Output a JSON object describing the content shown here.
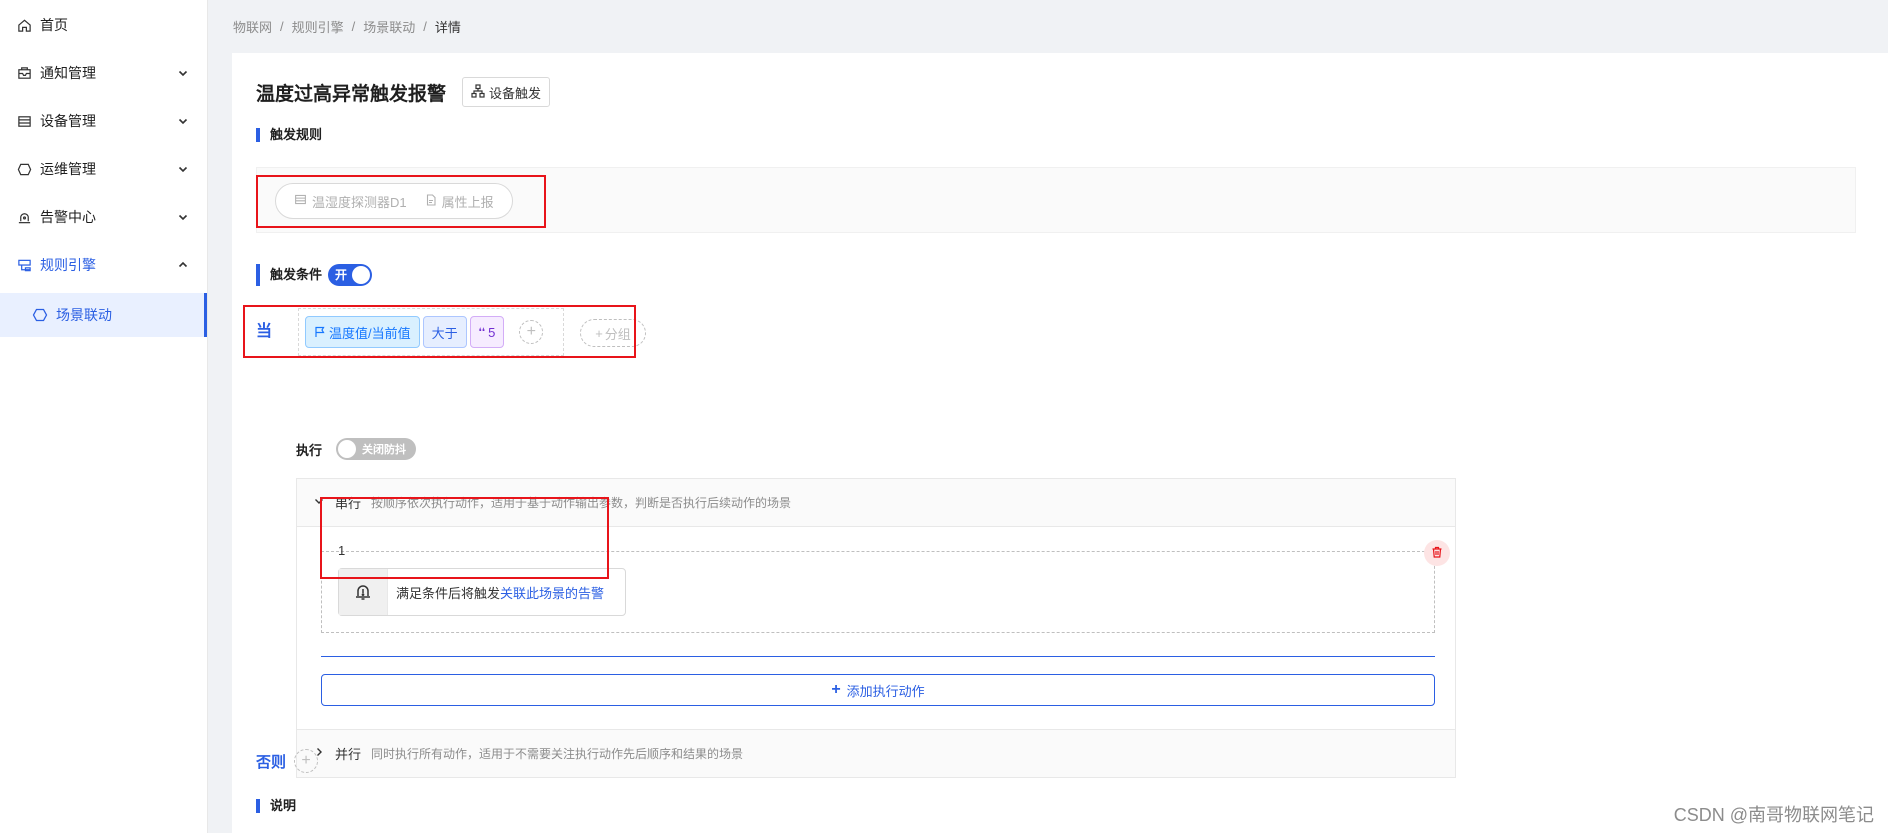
{
  "sidebar": {
    "items": [
      {
        "label": "首页",
        "icon": "home-icon"
      },
      {
        "label": "通知管理",
        "icon": "inbox-icon"
      },
      {
        "label": "设备管理",
        "icon": "device-list-icon"
      },
      {
        "label": "运维管理",
        "icon": "ops-shield-icon"
      },
      {
        "label": "告警中心",
        "icon": "alarm-icon"
      },
      {
        "label": "规则引擎",
        "icon": "rule-engine-icon"
      }
    ],
    "sub_item": {
      "label": "场景联动",
      "icon": "scene-icon"
    }
  },
  "breadcrumb": [
    "物联网",
    "规则引擎",
    "场景联动",
    "详情"
  ],
  "header": {
    "title": "温度过高异常触发报警",
    "trigger_tag": "设备触发"
  },
  "trigger_rule": {
    "label": "触发规则",
    "device": "温湿度探测器D1",
    "event": "属性上报"
  },
  "condition": {
    "label": "触发条件",
    "toggle": "开",
    "when": "当",
    "property": "温度值/当前值",
    "operator": "大于",
    "value": "5",
    "add_group": "分组"
  },
  "execute": {
    "label": "执行",
    "debounce": "关闭防抖",
    "serial": {
      "name": "串行",
      "desc": "按顺序依次执行动作，适用于基于动作输出参数，判断是否执行后续动作的场景"
    },
    "step_number": "1",
    "action_text": "满足条件后将触发",
    "action_link": "关联此场景的告警",
    "add_action": "添加执行动作",
    "parallel": {
      "name": "并行",
      "desc": "同时执行所有动作，适用于不需要关注执行动作先后顺序和结果的场景"
    }
  },
  "else_label": "否则",
  "description_label": "说明",
  "watermark": "CSDN @南哥物联网笔记",
  "colors": {
    "accent": "#2b5fe3",
    "highlight": "#e8141a"
  }
}
